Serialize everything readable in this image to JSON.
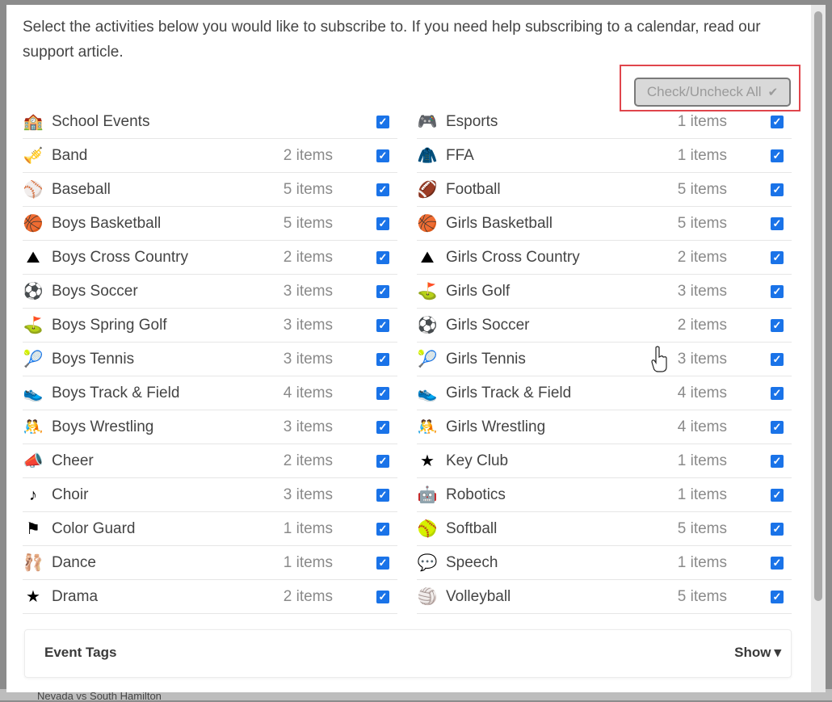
{
  "intro_text": "Select the activities below you would like to subscribe to. If you need help subscribing to a calendar, read our support article.",
  "check_all_label": "Check/Uncheck All",
  "left_column": [
    {
      "name": "School Events",
      "count": "",
      "icon": "school-icon",
      "glyph": "🏫"
    },
    {
      "name": "Band",
      "count": "2 items",
      "icon": "trumpet-icon",
      "glyph": "🎺"
    },
    {
      "name": "Baseball",
      "count": "5 items",
      "icon": "baseball-icon",
      "glyph": "⚾"
    },
    {
      "name": "Boys Basketball",
      "count": "5 items",
      "icon": "basketball-icon",
      "glyph": "🏀"
    },
    {
      "name": "Boys Cross Country",
      "count": "2 items",
      "icon": "mountain-icon",
      "glyph": "⛰"
    },
    {
      "name": "Boys Soccer",
      "count": "3 items",
      "icon": "soccer-ball-icon",
      "glyph": "⚽"
    },
    {
      "name": "Boys Spring Golf",
      "count": "3 items",
      "icon": "golf-green-icon",
      "glyph": "⛳"
    },
    {
      "name": "Boys Tennis",
      "count": "3 items",
      "icon": "tennis-ball-icon",
      "glyph": "🎾"
    },
    {
      "name": "Boys Track & Field",
      "count": "4 items",
      "icon": "running-shoe-icon",
      "glyph": "👟"
    },
    {
      "name": "Boys Wrestling",
      "count": "3 items",
      "icon": "wrestling-headgear-icon",
      "glyph": "🤼"
    },
    {
      "name": "Cheer",
      "count": "2 items",
      "icon": "megaphone-icon",
      "glyph": "📣"
    },
    {
      "name": "Choir",
      "count": "3 items",
      "icon": "music-note-icon",
      "glyph": "♪"
    },
    {
      "name": "Color Guard",
      "count": "1 items",
      "icon": "flag-icon",
      "glyph": "⚑"
    },
    {
      "name": "Dance",
      "count": "1 items",
      "icon": "ballet-shoes-icon",
      "glyph": "🩰"
    },
    {
      "name": "Drama",
      "count": "2 items",
      "icon": "star-icon",
      "glyph": "★"
    }
  ],
  "right_column": [
    {
      "name": "Esports",
      "count": "1 items",
      "icon": "game-controller-icon",
      "glyph": "🎮"
    },
    {
      "name": "FFA",
      "count": "1 items",
      "icon": "jacket-icon",
      "glyph": "🧥"
    },
    {
      "name": "Football",
      "count": "5 items",
      "icon": "football-icon",
      "glyph": "🏈"
    },
    {
      "name": "Girls Basketball",
      "count": "5 items",
      "icon": "basketball-icon",
      "glyph": "🏀"
    },
    {
      "name": "Girls Cross Country",
      "count": "2 items",
      "icon": "mountain-icon",
      "glyph": "⛰"
    },
    {
      "name": "Girls Golf",
      "count": "3 items",
      "icon": "golf-green-icon",
      "glyph": "⛳"
    },
    {
      "name": "Girls Soccer",
      "count": "2 items",
      "icon": "soccer-ball-icon",
      "glyph": "⚽"
    },
    {
      "name": "Girls Tennis",
      "count": "3 items",
      "icon": "tennis-ball-icon",
      "glyph": "🎾"
    },
    {
      "name": "Girls Track & Field",
      "count": "4 items",
      "icon": "running-shoe-icon",
      "glyph": "👟"
    },
    {
      "name": "Girls Wrestling",
      "count": "4 items",
      "icon": "wrestling-headgear-icon",
      "glyph": "🤼"
    },
    {
      "name": "Key Club",
      "count": "1 items",
      "icon": "star-icon",
      "glyph": "★"
    },
    {
      "name": "Robotics",
      "count": "1 items",
      "icon": "robot-icon",
      "glyph": "🤖"
    },
    {
      "name": "Softball",
      "count": "5 items",
      "icon": "softball-icon",
      "glyph": "🥎"
    },
    {
      "name": "Speech",
      "count": "1 items",
      "icon": "speech-bubble-icon",
      "glyph": "💬"
    },
    {
      "name": "Volleyball",
      "count": "5 items",
      "icon": "volleyball-icon",
      "glyph": "🏐"
    }
  ],
  "event_tags": {
    "label": "Event Tags",
    "toggle": "Show"
  },
  "background_text": "Nevada vs South Hamilton",
  "colors": {
    "checkbox": "#1a73e8",
    "highlight": "#e0454c"
  }
}
